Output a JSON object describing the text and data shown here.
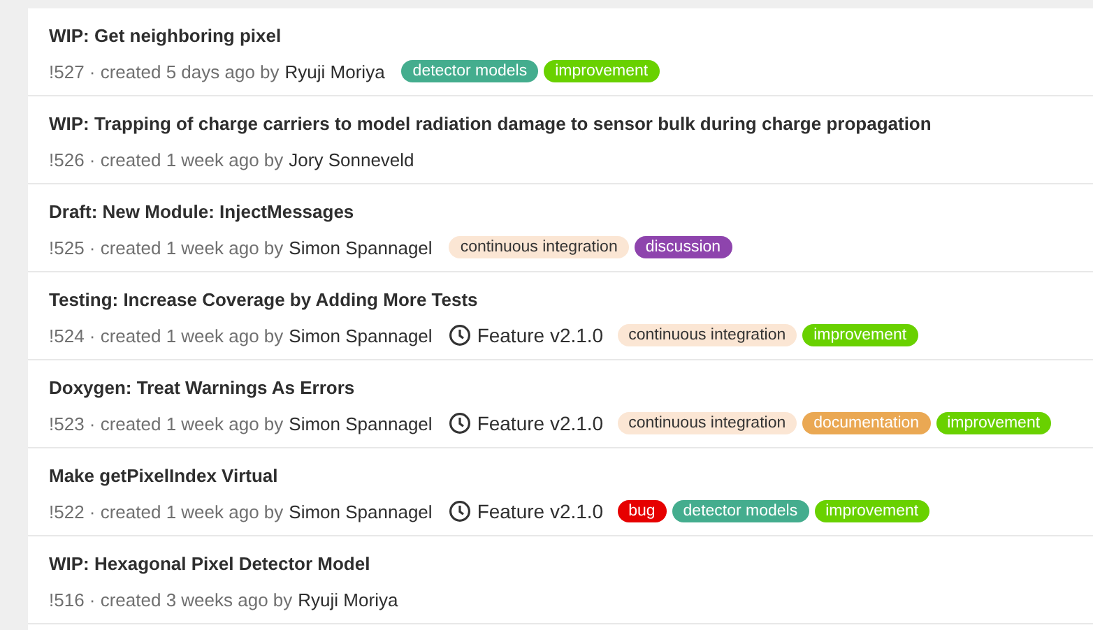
{
  "merge_requests": [
    {
      "title": "WIP: Get neighboring pixel",
      "ref": "!527 · created 5 days ago by",
      "author": "Ryuji Moriya",
      "labels": [
        {
          "text": "detector models",
          "color": "#44ad8e"
        },
        {
          "text": "improvement",
          "color": "#69d100"
        }
      ]
    },
    {
      "title": "WIP: Trapping of charge carriers to model radiation damage to sensor bulk during charge propagation",
      "ref": "!526 · created 1 week ago by",
      "author": "Jory Sonneveld"
    },
    {
      "title": "Draft: New Module: InjectMessages",
      "ref": "!525 · created 1 week ago by",
      "author": "Simon Spannagel",
      "labels": [
        {
          "text": "continuous integration",
          "color": "#fbe6d4"
        },
        {
          "text": "discussion",
          "color": "#8e44ad"
        }
      ]
    },
    {
      "title": "Testing: Increase Coverage by Adding More Tests",
      "ref": "!524 · created 1 week ago by",
      "author": "Simon Spannagel",
      "milestone": "Feature v2.1.0",
      "labels": [
        {
          "text": "continuous integration",
          "color": "#fbe6d4"
        },
        {
          "text": "improvement",
          "color": "#69d100"
        }
      ]
    },
    {
      "title": "Doxygen: Treat Warnings As Errors",
      "ref": "!523 · created 1 week ago by",
      "author": "Simon Spannagel",
      "milestone": "Feature v2.1.0",
      "labels": [
        {
          "text": "continuous integration",
          "color": "#fbe6d4"
        },
        {
          "text": "documentation",
          "color": "#eaa853"
        },
        {
          "text": "improvement",
          "color": "#69d100"
        }
      ]
    },
    {
      "title": "Make getPixelIndex Virtual",
      "ref": "!522 · created 1 week ago by",
      "author": "Simon Spannagel",
      "milestone": "Feature v2.1.0",
      "labels": [
        {
          "text": "bug",
          "color": "#e60000"
        },
        {
          "text": "detector models",
          "color": "#44ad8e"
        },
        {
          "text": "improvement",
          "color": "#69d100"
        }
      ]
    },
    {
      "title": "WIP: Hexagonal Pixel Detector Model",
      "ref": "!516 · created 3 weeks ago by",
      "author": "Ryuji Moriya"
    }
  ]
}
